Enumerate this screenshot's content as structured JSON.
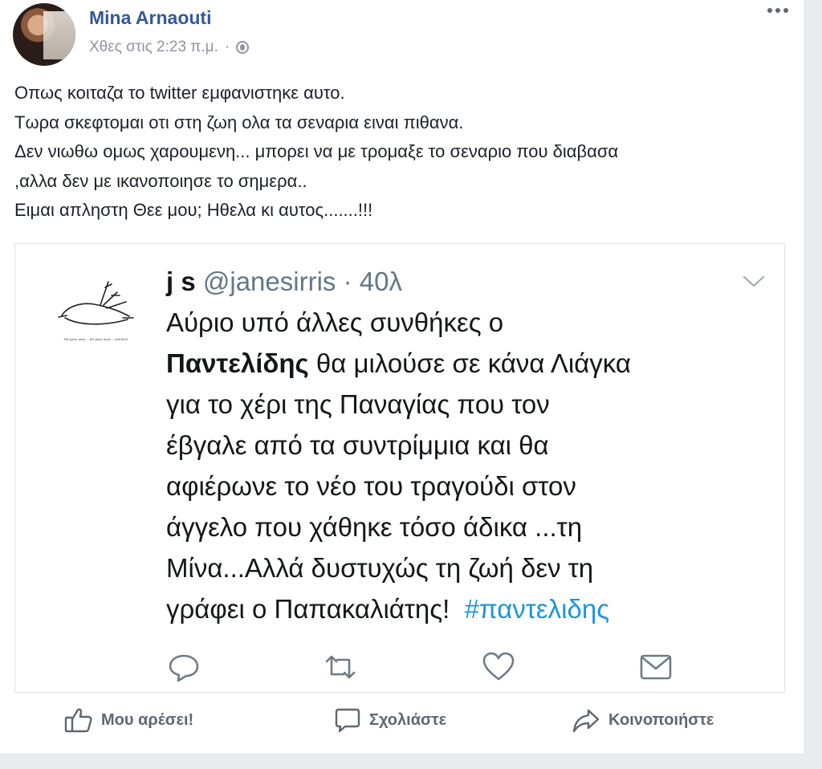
{
  "post": {
    "author": "Mina Arnaouti",
    "timestamp": "Χθες στις 2:23 π.μ.",
    "separator": "·",
    "more_icon": "more-dots-icon",
    "privacy_icon": "globe-icon",
    "text_lines": [
      "Οπως κοιταζα το twitter εμφανιστηκε αυτο.",
      "Τωρα σκεφτομαι οτι στη ζωη ολα τα σεναρια ειναι πιθανα.",
      "Δεν νιωθω ομως χαρουμενη... μπορει να με τρομαξε το σεναριο που διαβασα",
      ",αλλα δεν με ικανοποιησε το σημερα..",
      "Ειμαι απληστη Θεε μου; Ηθελα κι αυτος.......!!!"
    ]
  },
  "tweet": {
    "name": "j s",
    "handle": "@janesirris",
    "dot": "·",
    "time": "40λ",
    "lines": {
      "l1": "Αύριο υπό άλλες συνθήκες ο",
      "l2_bold": "Παντελίδης",
      "l2_rest": " θα μιλούσε σε κάνα Λιάγκα",
      "l3": "για το χέρι της Παναγίας που τον",
      "l4": "έβγαλε από τα συντρίμμια και θα",
      "l5": "αφιέρωνε το νέο του τραγούδι στον",
      "l6": "άγγελο που χάθηκε τόσο άδικα ...τη",
      "l7": "Μίνα...Αλλά δυστυχώς τη ζωή δεν τη",
      "l8_prefix": "γράφει ο Παπακαλιάτης!  ",
      "hashtag": "#παντελιδης"
    },
    "avatar_caption": "The party must ... the party must ... and died",
    "colors": {
      "hashtag": "#1b95e0",
      "meta": "#657786"
    }
  },
  "actions": {
    "like": "Μου αρέσει!",
    "comment": "Σχολιάστε",
    "share": "Κοινοποιήστε"
  },
  "colors": {
    "author": "#365899",
    "action_text": "#606770",
    "background": "#e9ebee"
  }
}
